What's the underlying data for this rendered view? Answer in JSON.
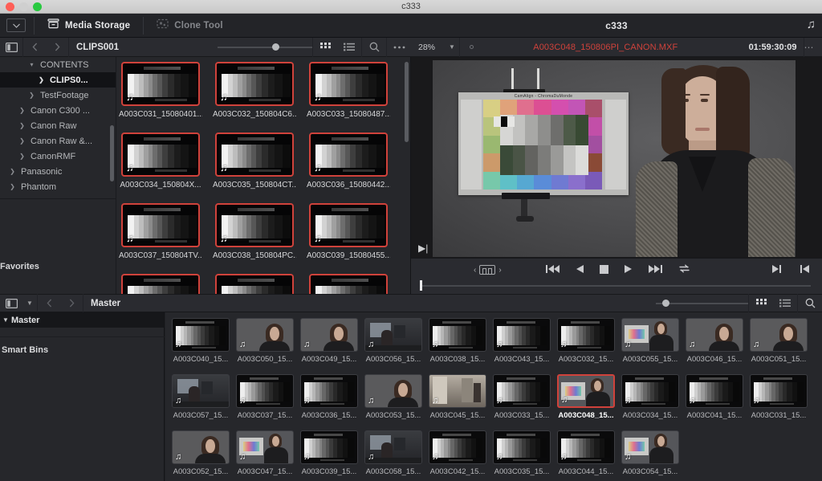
{
  "window": {
    "title": "c333"
  },
  "app_toolbar": {
    "disclosure_icon": "chevron-down-icon",
    "tabs": [
      {
        "id": "media-storage",
        "label": "Media Storage",
        "icon": "media-storage-icon",
        "active": true
      },
      {
        "id": "clone-tool",
        "label": "Clone Tool",
        "icon": "clone-tool-icon",
        "active": false
      }
    ],
    "project_title": "c333",
    "note_icon": "music-note-icon"
  },
  "media_storage_header": {
    "panel_toggle_icon": "panel-toggle-icon",
    "back_icon": "chevron-left-icon",
    "forward_icon": "chevron-right-icon",
    "breadcrumb": "CLIPS001",
    "grid_view_icon": "grid-view-icon",
    "list_view_icon": "list-view-icon",
    "search_icon": "search-icon",
    "options_icon": "ellipsis-icon"
  },
  "viewer_header": {
    "zoom_level": "28%",
    "zoom_chevron_icon": "chevron-down-icon",
    "clip_name": "A003C048_150806PI_CANON.MXF",
    "timecode": "01:59:30:09",
    "options_icon": "ellipsis-icon",
    "clip_name_color": "#d0423b"
  },
  "storage_tree": {
    "items": [
      {
        "label": "CONTENTS",
        "depth": 2,
        "arrow": "chevron-down-icon",
        "selected": false
      },
      {
        "label": "CLIPS0...",
        "depth": 3,
        "arrow": "chevron-right-icon",
        "selected": true
      },
      {
        "label": "TestFootage",
        "depth": 2,
        "arrow": "chevron-right-icon",
        "selected": false
      },
      {
        "label": "Canon C300 ...",
        "depth": 1,
        "arrow": "chevron-right-icon",
        "selected": false
      },
      {
        "label": "Canon Raw",
        "depth": 1,
        "arrow": "chevron-right-icon",
        "selected": false
      },
      {
        "label": "Canon Raw &...",
        "depth": 1,
        "arrow": "chevron-right-icon",
        "selected": false
      },
      {
        "label": "CanonRMF",
        "depth": 1,
        "arrow": "chevron-right-icon",
        "selected": false
      },
      {
        "label": "Panasonic",
        "depth": 0,
        "arrow": "chevron-right-icon",
        "selected": false
      },
      {
        "label": "Phantom",
        "depth": 0,
        "arrow": "chevron-right-icon",
        "selected": false
      }
    ],
    "favorites_label": "Favorites"
  },
  "storage_clips": [
    {
      "label": "A003C031_15080401...",
      "selected": true
    },
    {
      "label": "A003C032_150804C6...",
      "selected": true
    },
    {
      "label": "A003C033_15080487...",
      "selected": true
    },
    {
      "label": "A003C034_150804X...",
      "selected": true
    },
    {
      "label": "A003C035_150804CT...",
      "selected": true
    },
    {
      "label": "A003C036_15080442...",
      "selected": true
    },
    {
      "label": "A003C037_150804TV...",
      "selected": true
    },
    {
      "label": "A003C038_150804PC...",
      "selected": true
    },
    {
      "label": "A003C039_15080455...",
      "selected": true
    },
    {
      "label": "",
      "selected": true
    },
    {
      "label": "",
      "selected": true
    },
    {
      "label": "",
      "selected": true
    }
  ],
  "transport": {
    "frame_prev_icon": "chevron-left-icon",
    "frame_icon": "film-frame-icon",
    "frame_next_icon": "chevron-right-icon",
    "buttons": [
      {
        "id": "jump-to-start",
        "icon": "skip-back-icon"
      },
      {
        "id": "reverse-play",
        "icon": "play-reverse-icon"
      },
      {
        "id": "stop",
        "icon": "stop-icon"
      },
      {
        "id": "play",
        "icon": "play-icon"
      },
      {
        "id": "jump-to-end",
        "icon": "skip-forward-icon"
      },
      {
        "id": "loop",
        "icon": "loop-icon"
      }
    ],
    "right_buttons": [
      {
        "id": "mark-out",
        "icon": "mark-out-icon"
      },
      {
        "id": "mark-in",
        "icon": "mark-in-icon"
      }
    ]
  },
  "media_pool_header": {
    "panel_toggle_icon": "panel-toggle-icon",
    "disclosure_icon": "chevron-down-icon",
    "back_icon": "chevron-left-icon",
    "forward_icon": "chevron-right-icon",
    "breadcrumb": "Master",
    "grid_view_icon": "grid-view-icon",
    "list_view_icon": "list-view-icon",
    "search_icon": "search-icon"
  },
  "media_pool_sidebar": {
    "master_label": "Master",
    "master_arrow": "chevron-down-icon",
    "smart_bins_label": "Smart Bins"
  },
  "media_pool_clips": [
    {
      "label": "A003C040_15...",
      "kind": "chart",
      "selected": false
    },
    {
      "label": "A003C050_15...",
      "kind": "person",
      "selected": false
    },
    {
      "label": "A003C049_15...",
      "kind": "person",
      "selected": false
    },
    {
      "label": "A003C056_15...",
      "kind": "room",
      "selected": false
    },
    {
      "label": "A003C038_15...",
      "kind": "chart",
      "selected": false
    },
    {
      "label": "A003C043_15...",
      "kind": "chart",
      "selected": false
    },
    {
      "label": "A003C032_15...",
      "kind": "chart",
      "selected": false
    },
    {
      "label": "A003C055_15...",
      "kind": "chart-person",
      "selected": false
    },
    {
      "label": "A003C046_15...",
      "kind": "person",
      "selected": false
    },
    {
      "label": "A003C051_15...",
      "kind": "person",
      "selected": false
    },
    {
      "label": "A003C057_15...",
      "kind": "room",
      "selected": false
    },
    {
      "label": "A003C037_15...",
      "kind": "chart",
      "selected": false
    },
    {
      "label": "A003C036_15...",
      "kind": "chart",
      "selected": false
    },
    {
      "label": "A003C053_15...",
      "kind": "person",
      "selected": false
    },
    {
      "label": "A003C045_15...",
      "kind": "hallway",
      "selected": false
    },
    {
      "label": "A003C033_15...",
      "kind": "chart",
      "selected": false
    },
    {
      "label": "A003C048_15...",
      "kind": "chart-person",
      "selected": true
    },
    {
      "label": "A003C034_15...",
      "kind": "chart",
      "selected": false
    },
    {
      "label": "A003C041_15...",
      "kind": "chart",
      "selected": false
    },
    {
      "label": "A003C031_15...",
      "kind": "chart",
      "selected": false
    },
    {
      "label": "A003C052_15...",
      "kind": "person",
      "selected": false
    },
    {
      "label": "A003C047_15...",
      "kind": "chart-person",
      "selected": false
    },
    {
      "label": "A003C039_15...",
      "kind": "chart",
      "selected": false
    },
    {
      "label": "A003C058_15...",
      "kind": "room",
      "selected": false
    },
    {
      "label": "A003C042_15...",
      "kind": "chart",
      "selected": false
    },
    {
      "label": "A003C035_15...",
      "kind": "chart",
      "selected": false
    },
    {
      "label": "A003C044_15...",
      "kind": "chart",
      "selected": false
    },
    {
      "label": "A003C054_15...",
      "kind": "chart-person",
      "selected": false
    }
  ],
  "viewer_image": {
    "chart_title": "CamAlign - ChromaDuMonde",
    "description": "Woman seated beside a color calibration chart on a stand"
  },
  "colors": {
    "accent_red": "#d0423b",
    "panel_bg": "#26272b",
    "toolbar_bg": "#2a2b30",
    "app_bg": "#232428"
  }
}
